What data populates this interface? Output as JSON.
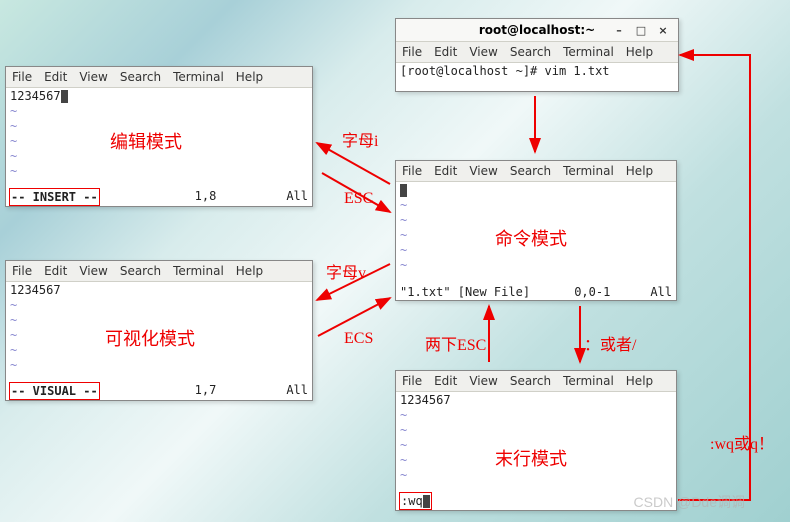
{
  "menu": {
    "file": "File",
    "edit": "Edit",
    "view": "View",
    "search": "Search",
    "terminal": "Terminal",
    "help": "Help"
  },
  "topwin": {
    "title": "root@localhost:~",
    "prompt": "[root@localhost ~]# vim 1.txt",
    "btn_min": "–",
    "btn_max": "□",
    "btn_close": "×"
  },
  "insert": {
    "text": "1234567",
    "mode": "-- INSERT --",
    "pos": "1,8",
    "pct": "All",
    "label": "编辑模式"
  },
  "visual": {
    "text": "1234567",
    "mode": "-- VISUAL --",
    "pos": "1,7",
    "pct": "All",
    "label": "可视化模式"
  },
  "command": {
    "status": "\"1.txt\" [New File]",
    "pos": "0,0-1",
    "pct": "All",
    "label": "命令模式"
  },
  "lastline": {
    "text": "1234567",
    "cmd": ":wq",
    "label": "末行模式"
  },
  "arrows": {
    "to_insert": "字母i",
    "from_insert": "ESC",
    "to_visual": "字母v",
    "from_visual": "ECS",
    "double_esc": "两下ESC",
    "to_lastline": "：或者/",
    "wq": ":wq或q！"
  },
  "watermark": "CSDN @Dde调调"
}
